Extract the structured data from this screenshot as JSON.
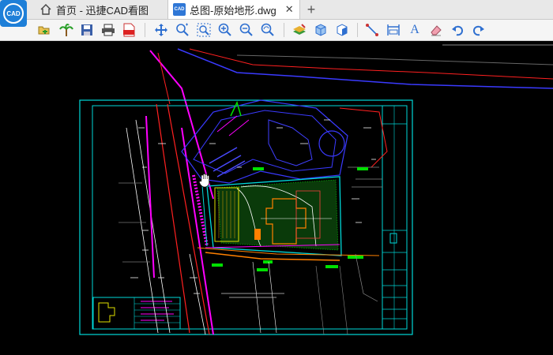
{
  "app": {
    "logo_text": "CAD"
  },
  "tabs": {
    "home_label": "首页 - 迅捷CAD看图",
    "doc_label": "总图-原始地形.dwg",
    "doc_badge": "CAD",
    "close_glyph": "✕",
    "add_glyph": "+"
  },
  "toolbar": {
    "items": [
      "open-icon",
      "palm-icon",
      "save-icon",
      "print-icon",
      "pdf-icon",
      "pan-icon",
      "zoom-realtime-icon",
      "zoom-window-icon",
      "zoom-in-icon",
      "zoom-out-icon",
      "zoom-previous-icon",
      "layers-icon",
      "3d-box-icon",
      "3d-view-icon",
      "measure-line-icon",
      "measure-dim-icon",
      "text-icon",
      "eraser-icon",
      "undo-icon",
      "redo-icon"
    ],
    "text_icon_label": "A"
  },
  "colors": {
    "accent": "#1e7fd8",
    "canvas_bg": "#000000",
    "frame_cyan": "#00d8d8",
    "magenta": "#ff00ff",
    "blue": "#3a3aff",
    "red": "#ff2020",
    "green": "#00e000",
    "orange": "#ff8000"
  }
}
